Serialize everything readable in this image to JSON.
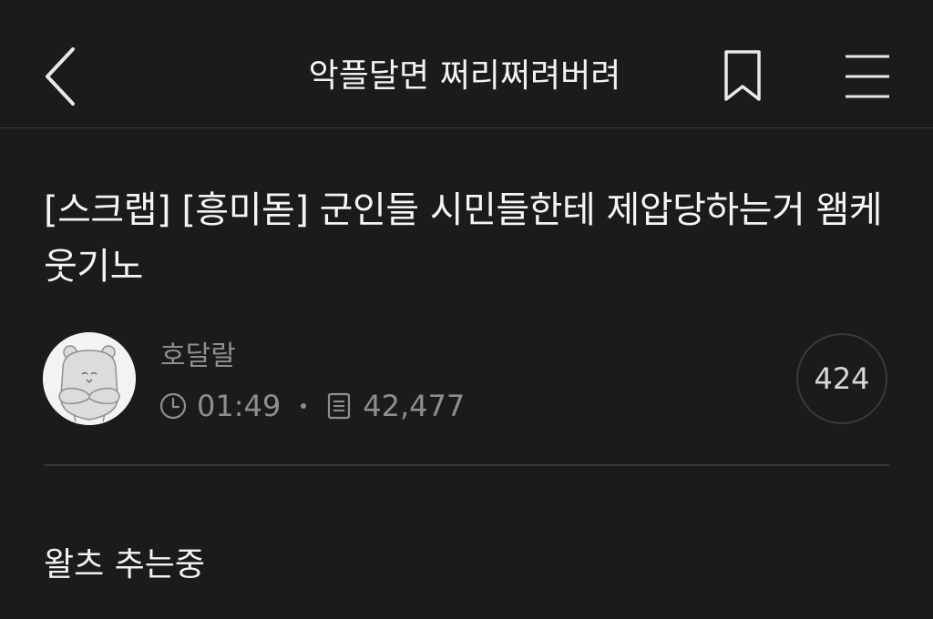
{
  "header": {
    "board_title": "악플달면 쩌리쩌려버려"
  },
  "post": {
    "title": "[스크랩] [흥미돋] 군인들 시민들한테 제압당하는거 왬케웃기노",
    "author": "호달랄",
    "time": "01:49",
    "views": "42,477",
    "comment_count": "424",
    "body": "왈츠 추는중"
  },
  "icons": {
    "back": "chevron-left-icon",
    "bookmark": "bookmark-icon",
    "menu": "hamburger-menu-icon",
    "clock": "clock-icon",
    "views": "document-icon"
  },
  "colors": {
    "background": "#1b1b1c",
    "text_primary": "#f2f2f2",
    "text_secondary": "#8e8e92",
    "divider": "#38383a"
  }
}
